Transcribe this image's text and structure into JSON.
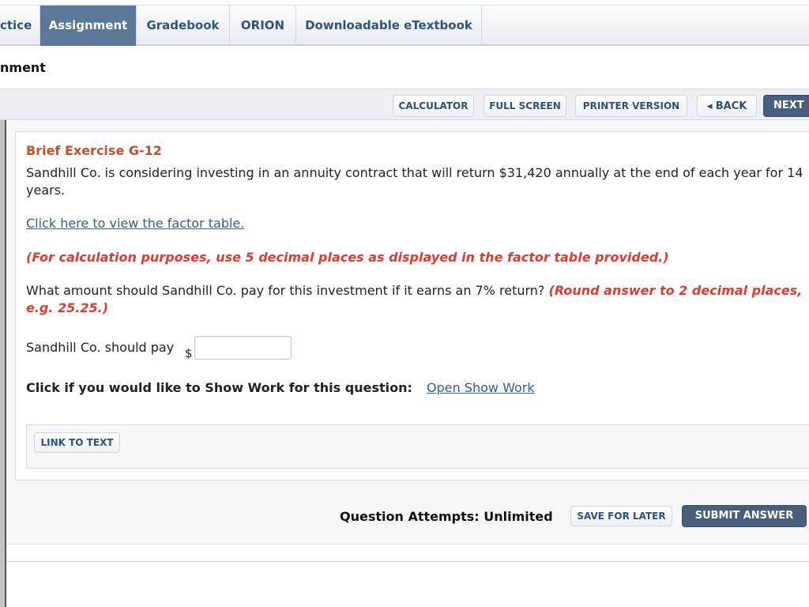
{
  "tabs": [
    {
      "label": "ctice",
      "active": false
    },
    {
      "label": "Assignment",
      "active": true
    },
    {
      "label": "Gradebook",
      "active": false
    },
    {
      "label": "ORION",
      "active": false
    },
    {
      "label": "Downloadable eTextbook",
      "active": false
    }
  ],
  "page_title": "nment",
  "toolbar": {
    "calculator": "CALCULATOR",
    "full_screen": "FULL SCREEN",
    "printer_version": "PRINTER VERSION",
    "back": "BACK",
    "next": "NEXT"
  },
  "question": {
    "title": "Brief Exercise G-12",
    "prompt_line1": "Sandhill Co. is considering investing in an annuity contract that will return $31,420 annually at the end of each year for 14",
    "prompt_line2": "years.",
    "factor_table_link": "Click here to view the factor table.",
    "calc_note": "(For calculation purposes, use 5 decimal places as displayed in the factor table provided.)",
    "ask": "What amount should Sandhill Co. pay for this investment if it earns an 7% return?",
    "round_note_1": "(Round answer to 2 decimal places,",
    "round_note_2": "e.g. 25.25.)",
    "answer_label": "Sandhill Co. should pay",
    "currency_symbol": "$",
    "answer_value": "",
    "show_work_label": "Click if you would like to Show Work for this question:",
    "show_work_link": "Open Show Work",
    "link_to_text": "LINK TO TEXT"
  },
  "footer": {
    "attempts": "Question Attempts: Unlimited",
    "save_for_later": "SAVE FOR LATER",
    "submit_answer": "SUBMIT ANSWER"
  }
}
